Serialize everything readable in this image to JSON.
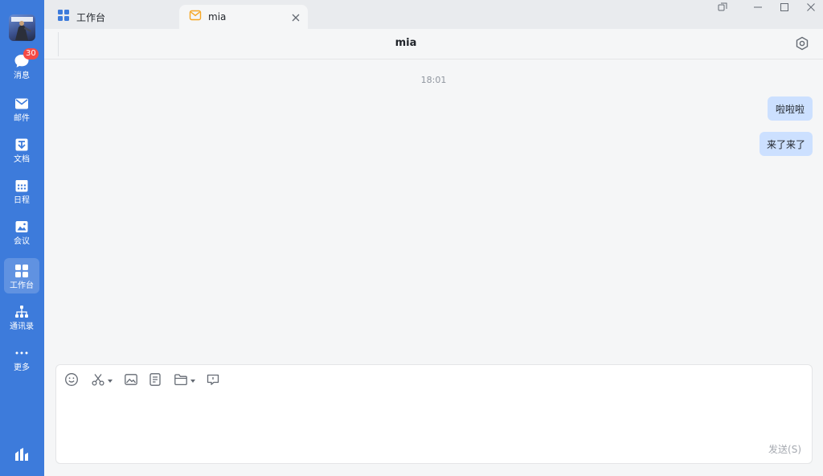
{
  "sidebar": {
    "items": [
      {
        "label": "消息",
        "badge": "30",
        "icon": "chat-bubble-icon"
      },
      {
        "label": "邮件",
        "icon": "mail-icon"
      },
      {
        "label": "文档",
        "icon": "document-icon"
      },
      {
        "label": "日程",
        "icon": "calendar-icon"
      },
      {
        "label": "会议",
        "icon": "meeting-icon"
      },
      {
        "label": "工作台",
        "icon": "grid-apps-icon",
        "active": true
      },
      {
        "label": "通讯录",
        "icon": "org-chart-icon"
      },
      {
        "label": "更多",
        "icon": "more-dots-icon"
      }
    ]
  },
  "tabs": [
    {
      "label": "工作台",
      "icon": "grid-apps-icon"
    },
    {
      "label": "mia",
      "icon": "mail-icon",
      "active": true
    }
  ],
  "chat": {
    "title": "mia",
    "timestamp": "18:01",
    "messages": [
      {
        "text": "啦啦啦",
        "side": "right"
      },
      {
        "text": "来了来了",
        "side": "right"
      }
    ]
  },
  "composer": {
    "send_label": "发送(S)",
    "tools": [
      "emoji-icon",
      "scissors-icon",
      "image-icon",
      "document-icon",
      "folder-icon",
      "comment-icon"
    ]
  },
  "colors": {
    "sidebar": "#3d7bdb",
    "bubble": "#cce0ff",
    "badge": "#f54a45"
  }
}
